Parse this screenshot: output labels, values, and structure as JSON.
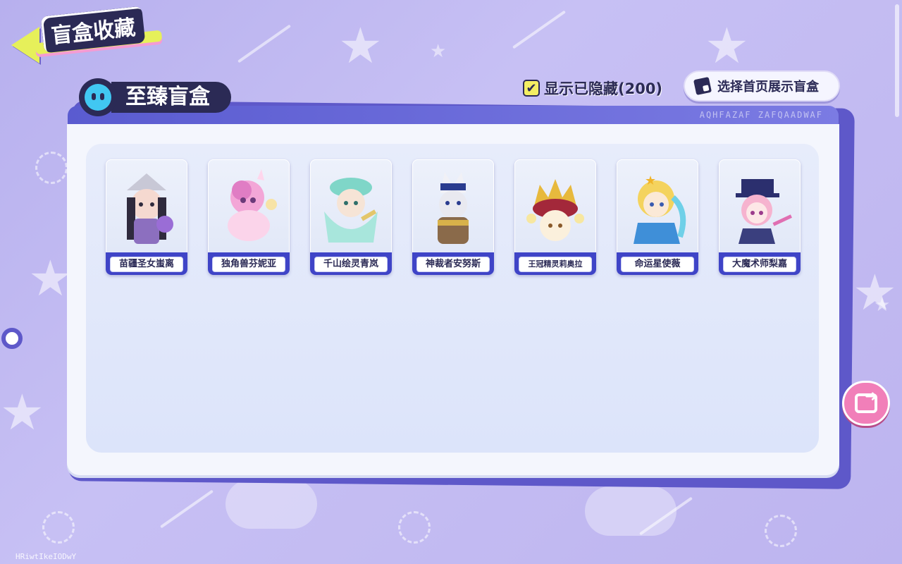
{
  "header": {
    "title": "盲盒收藏"
  },
  "controls": {
    "show_hidden_label": "显示已隐藏(200)",
    "show_hidden_checked": true,
    "select_display_label": "选择首页展示盲盒"
  },
  "section": {
    "title": "至臻盲盒",
    "decor_text": "AQHFAZAF ZAFQAADWAF"
  },
  "cards": [
    {
      "name": "苗疆圣女蚩离",
      "icon": "character-mystic-priestess"
    },
    {
      "name": "独角兽芬妮亚",
      "icon": "character-unicorn"
    },
    {
      "name": "千山绘灵青岚",
      "icon": "character-painter-spirit"
    },
    {
      "name": "神裁者安努斯",
      "icon": "character-anubis-judge"
    },
    {
      "name": "王冠精灵莉奥拉",
      "icon": "character-crown-spirit"
    },
    {
      "name": "命运星使薇",
      "icon": "character-star-envoy"
    },
    {
      "name": "大魔术师梨嘉",
      "icon": "character-magician"
    }
  ],
  "footer": {
    "user_id": "HRiwtIkeIODwY"
  },
  "colors": {
    "accent": "#2b2a55",
    "panel_border": "#5e58c9",
    "share_button": "#f17fb9",
    "checkbox": "#f3ee63"
  }
}
